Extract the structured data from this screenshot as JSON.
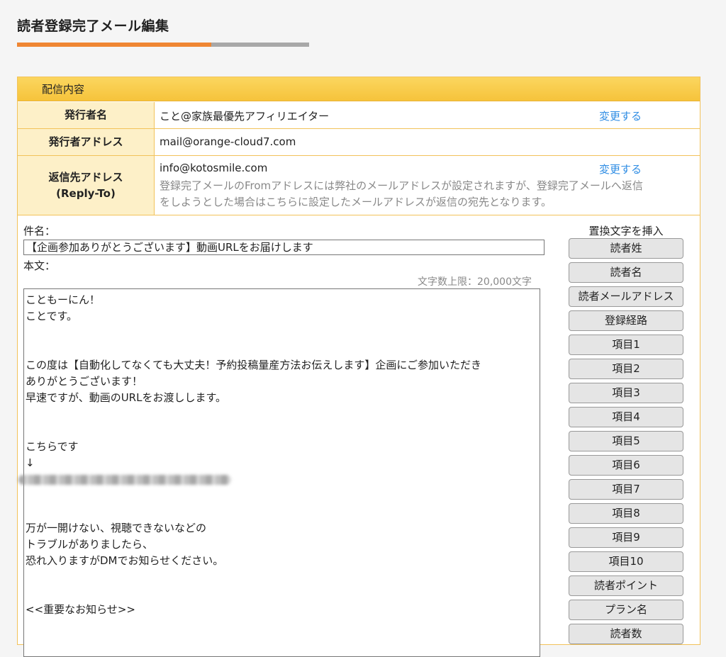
{
  "page": {
    "title": "読者登録完了メール編集"
  },
  "colors": {
    "accent": "#ef8633",
    "link": "#2f8de4",
    "header": "#f6c33b"
  },
  "panel": {
    "header": "配信内容"
  },
  "sender": {
    "label": "発行者名",
    "value": "こと@家族最優先アフィリエイター",
    "change": "変更する"
  },
  "sender_address": {
    "label": "発行者アドレス",
    "value": "mail@orange-cloud7.com"
  },
  "reply_to": {
    "label_line1": "返信先アドレス",
    "label_line2": "(Reply-To)",
    "value": "info@kotosmile.com",
    "change": "変更する",
    "note_line1": "登録完了メールのFromアドレスには弊社のメールアドレスが設定されますが、登録完了メールへ返信",
    "note_line2": "をしようとした場合はこちらに設定したメールアドレスが返信の宛先となります。"
  },
  "subject": {
    "label": "件名：",
    "value": "【企画参加ありがとうございます】動画URLをお届けします"
  },
  "body": {
    "label": "本文：",
    "limit": "文字数上限：20,000文字",
    "lines": [
      "こともーにん！",
      "ことです。",
      "",
      "",
      "この度は【自動化してなくても大丈夫！予約投稿量産方法お伝えします】企画にご参加いただき",
      "ありがとうございます！",
      "早速ですが、動画のURLをお渡しします。",
      "",
      "",
      "こちらです",
      "↓",
      "",
      "",
      "",
      "万が一開けない、視聴できないなどの",
      "トラブルがありましたら、",
      "恐れ入りますがDMでお知らせください。",
      "",
      "",
      "<<重要なお知らせ>>"
    ]
  },
  "insert": {
    "title": "置換文字を挿入",
    "buttons": [
      "読者姓",
      "読者名",
      "読者メールアドレス",
      "登録経路",
      "項目1",
      "項目2",
      "項目3",
      "項目4",
      "項目5",
      "項目6",
      "項目7",
      "項目8",
      "項目9",
      "項目10",
      "読者ポイント",
      "プラン名",
      "読者数"
    ]
  }
}
